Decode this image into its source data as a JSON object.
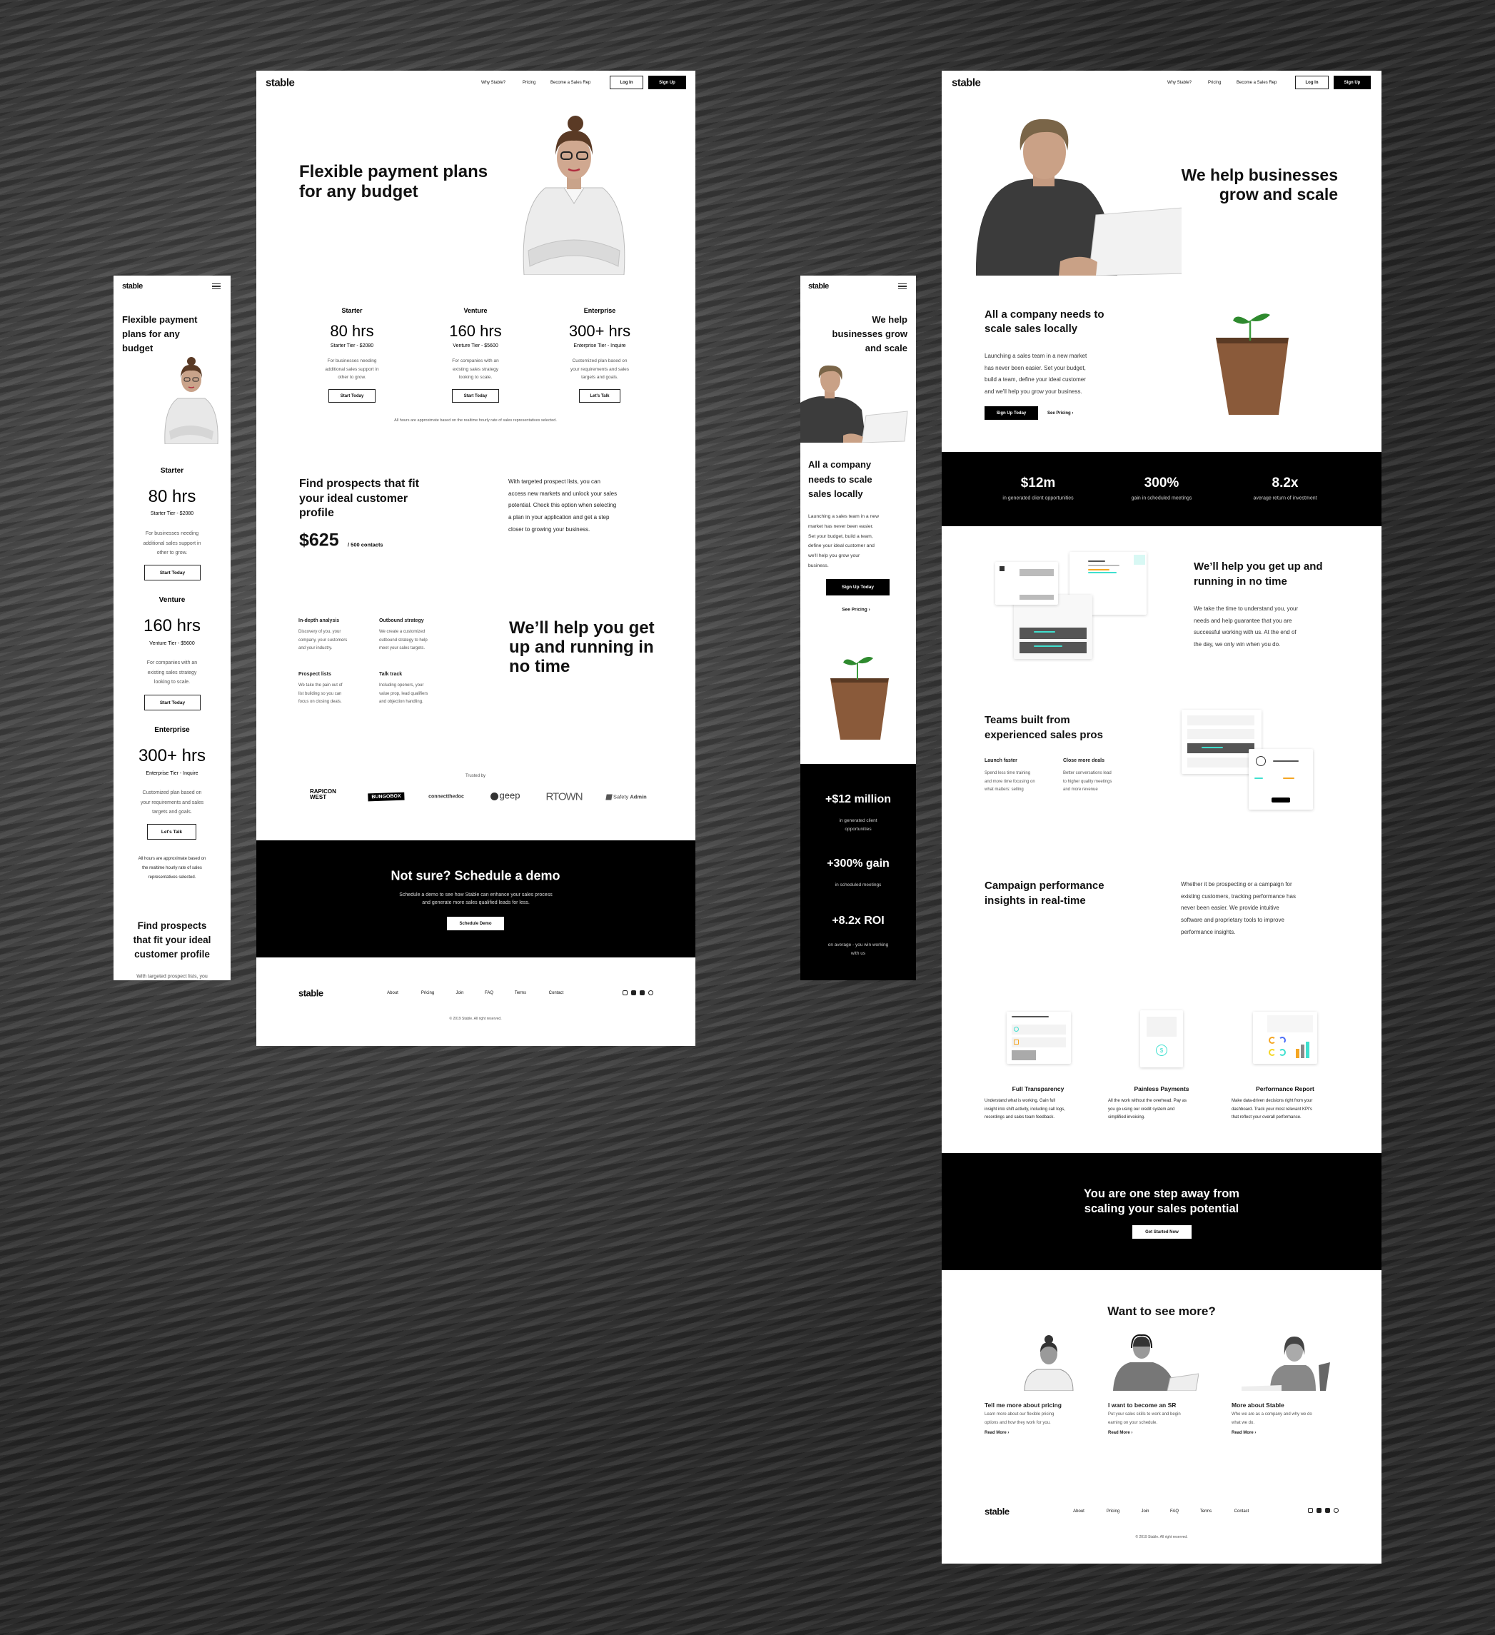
{
  "nav": {
    "logo": "stable",
    "links": [
      "Why Stable?",
      "Pricing",
      "Become a Sales Rep"
    ],
    "login": "Log In",
    "signup": "Sign Up"
  },
  "footer": {
    "logo": "stable",
    "links": [
      "About",
      "Pricing",
      "Join",
      "FAQ",
      "Terms",
      "Contact"
    ],
    "copyright": "© 2019 Stable. All right reserved.",
    "social_icons": [
      "instagram-icon",
      "facebook-icon",
      "twitter-icon",
      "pinterest-icon"
    ]
  },
  "pricing": {
    "hero_lines": [
      "Flexible payment plans",
      "for any budget"
    ],
    "tiers": [
      {
        "name": "Starter",
        "hours": "80 hrs",
        "subtitle": "Starter Tier - $2080",
        "desc": [
          "For businesses needing",
          "additional sales support in",
          "other to grow."
        ],
        "cta": "Start Today"
      },
      {
        "name": "Venture",
        "hours": "160 hrs",
        "subtitle": "Venture Tier - $5600",
        "desc": [
          "For companies with an",
          "existing sales strategy",
          "looking to scale."
        ],
        "cta": "Start Today"
      },
      {
        "name": "Enterprise",
        "hours": "300+ hrs",
        "subtitle": "Enterprise Tier - Inquire",
        "desc": [
          "Customized plan based on",
          "your requirements and sales",
          "targets and goals."
        ],
        "cta": "Let's Talk"
      }
    ],
    "note": "All hours are approximate based on the realtime hourly rate of sales representatives selected.",
    "prospects": {
      "title_lines": [
        "Find prospects that fit",
        "your ideal customer",
        "profile"
      ],
      "price": "$625",
      "price_unit": "/ 500 contacts",
      "body_lines": [
        "With targeted prospect lists, you can",
        "access new markets and unlock your sales",
        "potential. Check this option when selecting",
        "a plan in your application and get a step",
        "closer to growing your business."
      ]
    },
    "features": [
      {
        "title": "In-depth analysis",
        "lines": [
          "Discovery of you, your",
          "company, your customers",
          "and your industry."
        ]
      },
      {
        "title": "Outbound strategy",
        "lines": [
          "We create a customized",
          "outbound strategy to help",
          "meet your sales targets."
        ]
      },
      {
        "title": "Prospect lists",
        "lines": [
          "We take the pain out of",
          "list building so you can",
          "focus on closing deals."
        ]
      },
      {
        "title": "Talk track",
        "lines": [
          "Including openers, your",
          "value prop, lead qualifiers",
          "and objection handling."
        ]
      }
    ],
    "help_lines": [
      "We’ll help you get",
      "up and running in",
      "no time"
    ],
    "trusted_by": "Trusted by",
    "logos": [
      "RAPICON",
      "WEST",
      "BUNGOBOX",
      "connectthedoc",
      "geep",
      "RTOWN",
      "Safety",
      "Admin"
    ],
    "demo": {
      "title": "Not sure? Schedule a demo",
      "body_lines": [
        "Schedule a demo to see how Stable can enhance your sales process",
        "and generate more sales qualified leads for less."
      ],
      "cta": "Schedule Demo"
    }
  },
  "mobile_pricing": {
    "hero_lines": [
      "Flexible payment",
      "plans for any",
      "budget"
    ],
    "note_lines": [
      "All hours are approximate based on",
      "the realtime hourly rate of sales",
      "representatives selected."
    ],
    "prospects_lines": [
      "Find prospects",
      "that fit your ideal",
      "customer profile"
    ],
    "prospects_body": "With targeted prospect lists, you"
  },
  "home": {
    "hero_lines": [
      "We help businesses",
      "grow and scale"
    ],
    "scale": {
      "title_lines": [
        "All a company needs to",
        "scale sales locally"
      ],
      "body_lines": [
        "Launching a sales team in a new market",
        "has never been easier. Set your budget,",
        "build a team, define your ideal customer",
        "and we'll help you grow your business."
      ],
      "cta": "Sign Up Today",
      "link": "See Pricing"
    },
    "stats": [
      {
        "value": "$12m",
        "label": "in generated client opportunities"
      },
      {
        "value": "300%",
        "label": "gain in scheduled meetings"
      },
      {
        "value": "8.2x",
        "label": "average return of investment"
      }
    ],
    "running": {
      "title_lines": [
        "We’ll help you get up and",
        "running in no time"
      ],
      "body_lines": [
        "We take the time to understand you, your",
        "needs and help guarantee that you are",
        "successful working with us. At the end of",
        "the day, we only win when you do."
      ]
    },
    "teams": {
      "title_lines": [
        "Teams built from",
        "experienced sales pros"
      ],
      "items": [
        {
          "title": "Launch faster",
          "lines": [
            "Spend less time training",
            "and more time focusing on",
            "what matters: selling"
          ]
        },
        {
          "title": "Close more deals",
          "lines": [
            "Better conversations lead",
            "to higher quality meetings",
            "and more revenue"
          ]
        }
      ]
    },
    "campaign": {
      "title_lines": [
        "Campaign performance",
        "insights in real-time"
      ],
      "body_lines": [
        "Whether it be prospecting or a campaign for",
        "existing customers, tracking performance has",
        "never been easier. We provide intuitive",
        "software and proprietary tools to improve",
        "performance insights."
      ]
    },
    "cards": [
      {
        "title": "Full Transparency",
        "lines": [
          "Understand what is working. Gain full",
          "insight into shift activity, including call logs,",
          "recordings and sales team feedback."
        ]
      },
      {
        "title": "Painless Payments",
        "lines": [
          "All the work without the overhead. Pay as",
          "you go using our credit system and",
          "simplified invoicing."
        ]
      },
      {
        "title": "Performance Report",
        "lines": [
          "Make data-driven decisions right from your",
          "dashboard. Track your most relevant KPI's",
          "that reflect your overall performance."
        ]
      }
    ],
    "cta": {
      "title_lines": [
        "You are one step away from",
        "scaling your sales potential"
      ],
      "button": "Get Started Now"
    },
    "more": {
      "title": "Want to see more?",
      "items": [
        {
          "title": "Tell me more about pricing",
          "lines": [
            "Learn more about our flexible pricing",
            "options and how they work for you."
          ],
          "link": "Read More"
        },
        {
          "title": "I want to become an SR",
          "lines": [
            "Put your sales skills to work and begin",
            "earning on your schedule."
          ],
          "link": "Read More"
        },
        {
          "title": "More about Stable",
          "lines": [
            "Who we are as a company and why we do",
            "what we do."
          ],
          "link": "Read More"
        }
      ]
    }
  },
  "mobile_home": {
    "hero_lines": [
      "We help",
      "businesses grow",
      "and scale"
    ],
    "title_lines": [
      "All a company",
      "needs to scale",
      "sales locally"
    ],
    "body_lines": [
      "Launching a sales team in a new",
      "market has never been easier.",
      "Set your budget, build a team,",
      "define your ideal customer and",
      "we'll help you grow your",
      "business."
    ],
    "stats": [
      {
        "value": "+$12 million",
        "label_lines": [
          "in generated client",
          "opportunities"
        ]
      },
      {
        "value": "+300% gain",
        "label_lines": [
          "in scheduled meetings"
        ]
      },
      {
        "value": "+8.2x ROI",
        "label_lines": [
          "on average - you win working",
          "with us"
        ]
      }
    ]
  },
  "colors": {
    "accent_teal": "#3fe0cf",
    "accent_orange": "#f5a623",
    "black": "#000000"
  }
}
